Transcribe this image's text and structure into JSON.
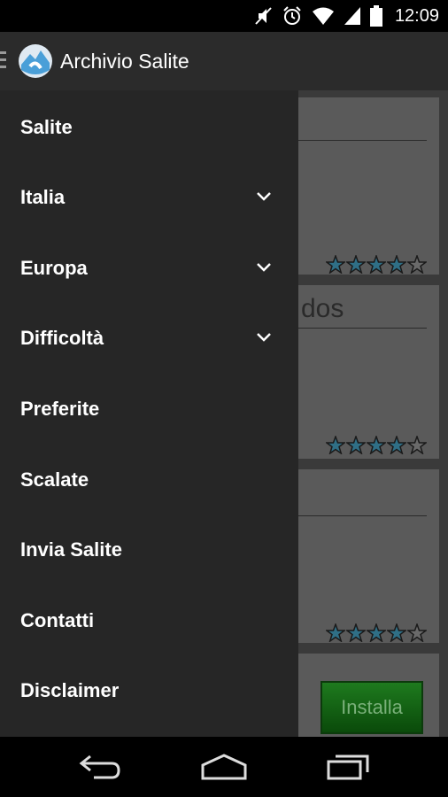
{
  "status_bar": {
    "time": "12:09",
    "icons": [
      "mute-icon",
      "alarm-icon",
      "wifi-icon",
      "signal-icon",
      "battery-icon"
    ]
  },
  "action_bar": {
    "title": "Archivio Salite",
    "icons": [
      "hamburger-icon",
      "app-logo-icon"
    ]
  },
  "drawer": {
    "items": [
      {
        "label": "Salite",
        "expandable": false
      },
      {
        "label": "Italia",
        "expandable": true
      },
      {
        "label": "Europa",
        "expandable": true
      },
      {
        "label": "Difficoltà",
        "expandable": true
      },
      {
        "label": "Preferite",
        "expandable": false
      },
      {
        "label": "Scalate",
        "expandable": false
      },
      {
        "label": "Invia Salite",
        "expandable": false
      },
      {
        "label": "Contatti",
        "expandable": false
      },
      {
        "label": "Disclaimer",
        "expandable": false
      }
    ]
  },
  "background": {
    "card_snippet": "dos",
    "ratings": [
      4,
      4,
      4
    ],
    "rating_max": 5,
    "install_label": "Installa"
  },
  "nav_bar": {
    "icons": [
      "back-icon",
      "home-icon",
      "recents-icon"
    ]
  },
  "colors": {
    "drawer_bg": "#262626",
    "action_bar_bg": "#2b2b2b",
    "star_fill": "#2f6f86",
    "install_green": "#1e7a1e"
  }
}
